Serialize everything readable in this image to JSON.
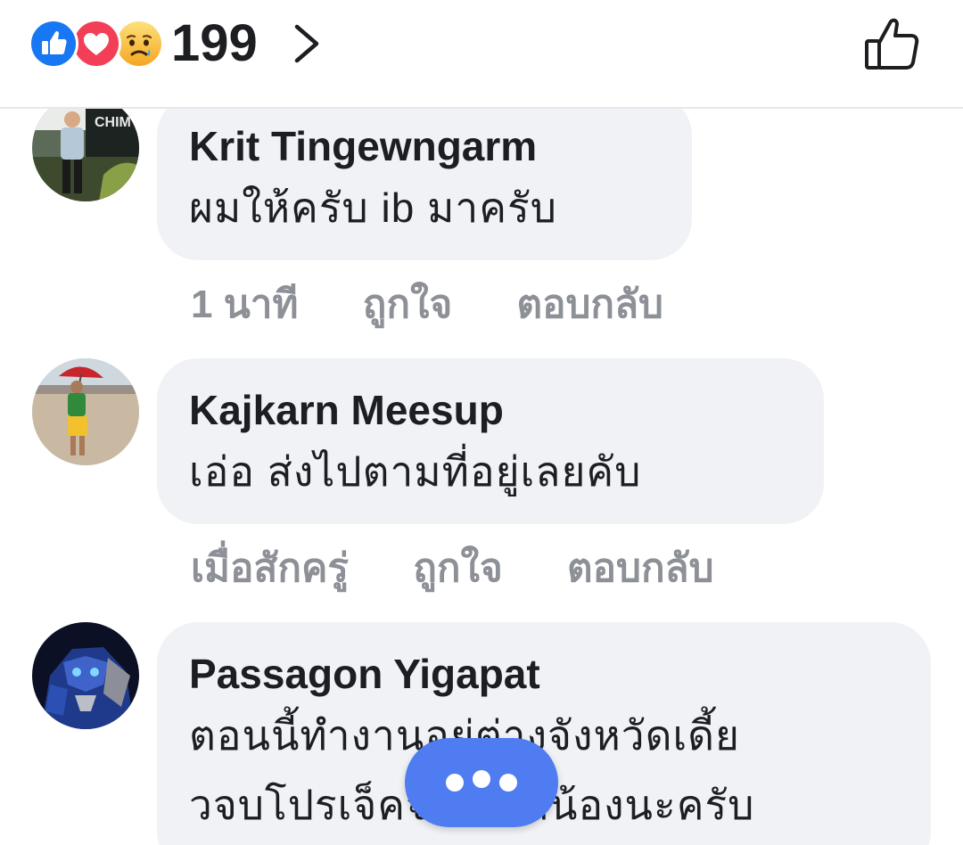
{
  "header": {
    "reactions": [
      "like-icon",
      "love-icon",
      "sad-icon"
    ],
    "reaction_count": "199",
    "colors": {
      "like": "#1877f2",
      "love": "#f33e58",
      "sad": "#f7b125"
    }
  },
  "comments": [
    {
      "author": "Krit Tingewngarm",
      "text": "ผมให้ครับ ib มาครับ",
      "time": "1 นาที",
      "like_label": "ถูกใจ",
      "reply_label": "ตอบกลับ"
    },
    {
      "author": "Kajkarn Meesup",
      "text": "เอ่อ  ส่งไปตามที่อยู่เลยคับ",
      "time": "เมื่อสักครู่",
      "like_label": "ถูกใจ",
      "reply_label": "ตอบกลับ"
    },
    {
      "author": "Passagon Yigapat",
      "text_line1": "ตอนนี้ทำงานอยู่ต่างจังหวัดเดี้ย",
      "text_line2": "วจบโปรเจ็คจะส่งให้น้องนะครับ"
    }
  ]
}
